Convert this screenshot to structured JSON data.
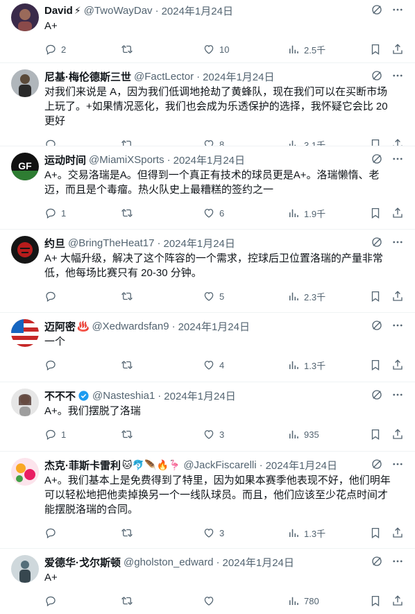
{
  "colors": {
    "text": "#0f1419",
    "secondary": "#536471",
    "border": "#eff3f4",
    "verified": "#1d9bf0"
  },
  "tweets": [
    {
      "name": "David",
      "name_emoji": "⚡",
      "handle": "@TwoWayDav",
      "date": "2024年1月24日",
      "text": "A+",
      "replies": "2",
      "retweets": "",
      "likes": "10",
      "views": "2.5千",
      "avatar_colors": [
        "#3a2a4a",
        "#9a6a5a"
      ]
    },
    {
      "name": "尼基·梅伦德斯三世",
      "name_emoji": "",
      "handle": "@FactLector",
      "date": "2024年1月24日",
      "text": "对我们来说是 A，因为我们低调地抢劫了黄蜂队，现在我们可以在买断市场上玩了。+如果情况恶化，我们也会成为乐透保护的选择，我怀疑它会比 20 更好",
      "replies": "",
      "retweets": "",
      "likes": "8",
      "views": "3.1千",
      "avatar_colors": [
        "#9aa0a6",
        "#2a2a2a"
      ]
    },
    {
      "name": "运动时间",
      "name_emoji": "",
      "handle": "@MiamiXSports",
      "date": "2024年1月24日",
      "text": "A+。交易洛瑞是A。但得到一个真正有技术的球员更是A+。洛瑞懒惰、老迈，而且是个毒瘤。热火队史上最糟糕的签约之一",
      "replies": "1",
      "retweets": "",
      "likes": "6",
      "views": "1.9千",
      "avatar_colors": [
        "#111111",
        "#2e7d32"
      ]
    },
    {
      "name": "约旦",
      "name_emoji": "",
      "handle": "@BringTheHeat17",
      "date": "2024年1月24日",
      "text": "A+ 大幅升级，解决了这个阵容的一个需求，控球后卫位置洛瑞的产量非常低，他每场比赛只有 20-30 分钟。",
      "replies": "",
      "retweets": "",
      "likes": "5",
      "views": "2.3千",
      "avatar_colors": [
        "#151515",
        "#b71c1c"
      ]
    },
    {
      "name": "迈阿密",
      "name_emoji": "♨️",
      "handle": "@Xedwardsfan9",
      "date": "2024年1月24日",
      "text": "一个",
      "replies": "",
      "retweets": "",
      "likes": "4",
      "views": "1.3千",
      "avatar_colors": [
        "#c62828",
        "#1565c0"
      ]
    },
    {
      "name": "不不不",
      "name_emoji": "",
      "verified": true,
      "handle": "@Nasteshia1",
      "date": "2024年1月24日",
      "text": "A+。我们摆脱了洛瑞",
      "replies": "1",
      "retweets": "",
      "likes": "3",
      "views": "935",
      "avatar_colors": [
        "#e0e0e0",
        "#5d4037"
      ]
    },
    {
      "name": "杰克·菲斯卡雷利",
      "name_emoji": "🐱🐬🪶🔥🦩",
      "handle": "@JackFiscarelli",
      "date": "2024年1月24日",
      "text": "A+。我们基本上是免费得到了特里，因为如果本赛季他表现不好，他们明年可以轻松地把他卖掉换另一个一线队球员。而且，他们应该至少花点时间才能摆脱洛瑞的合同。",
      "replies": "",
      "retweets": "",
      "likes": "3",
      "views": "1.3千",
      "avatar_colors": [
        "#f9a825",
        "#e91e63"
      ]
    },
    {
      "name": "爱德华·戈尔斯顿",
      "name_emoji": "",
      "handle": "@gholston_edward",
      "date": "2024年1月24日",
      "text": "A+",
      "replies": "",
      "retweets": "",
      "likes": "",
      "views": "780",
      "avatar_colors": [
        "#90a4ae",
        "#37474f"
      ]
    }
  ]
}
